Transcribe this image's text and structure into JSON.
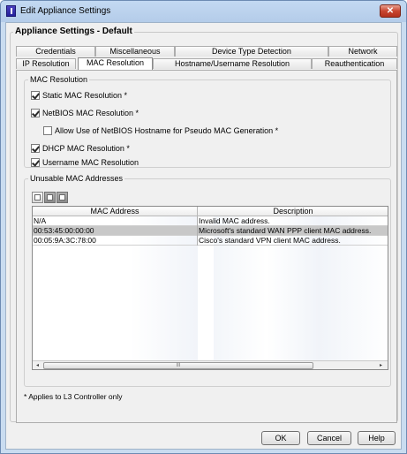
{
  "window": {
    "title": "Edit Appliance Settings",
    "close_glyph": "✕"
  },
  "settings_group": {
    "title": "Appliance Settings - Default"
  },
  "tabs": {
    "row1": [
      {
        "label": "Credentials"
      },
      {
        "label": "Miscellaneous"
      },
      {
        "label": "Device Type Detection"
      },
      {
        "label": "Network"
      }
    ],
    "row2": [
      {
        "label": "IP Resolution"
      },
      {
        "label": "MAC Resolution"
      },
      {
        "label": "Hostname/Username Resolution"
      },
      {
        "label": "Reauthentication"
      }
    ],
    "selected": "MAC Resolution"
  },
  "mac_resolution": {
    "title": "MAC Resolution",
    "options": [
      {
        "label": "Static MAC Resolution *",
        "checked": true
      },
      {
        "label": "NetBIOS MAC Resolution *",
        "checked": true
      },
      {
        "label": "Allow Use of NetBIOS Hostname for Pseudo MAC Generation *",
        "checked": false
      },
      {
        "label": "DHCP MAC Resolution *",
        "checked": true
      },
      {
        "label": "Username MAC Resolution",
        "checked": true
      }
    ]
  },
  "unusable_macs": {
    "title": "Unusable MAC Addresses",
    "toolbar": [
      "add-icon",
      "edit-icon",
      "delete-icon"
    ],
    "columns": [
      "MAC Address",
      "Description"
    ],
    "rows": [
      {
        "mac": "N/A",
        "description": "Invalid MAC address.",
        "selected": false
      },
      {
        "mac": "00:53:45:00:00:00",
        "description": "Microsoft's standard WAN PPP client MAC address.",
        "selected": true
      },
      {
        "mac": "00:05:9A:3C:78:00",
        "description": "Cisco's standard VPN client MAC address.",
        "selected": false
      }
    ],
    "scroll_left": "◂",
    "scroll_right": "▸",
    "scroll_grip": "III"
  },
  "footnote": "* Applies to L3 Controller only",
  "buttons": {
    "ok": "OK",
    "cancel": "Cancel",
    "help": "Help"
  }
}
